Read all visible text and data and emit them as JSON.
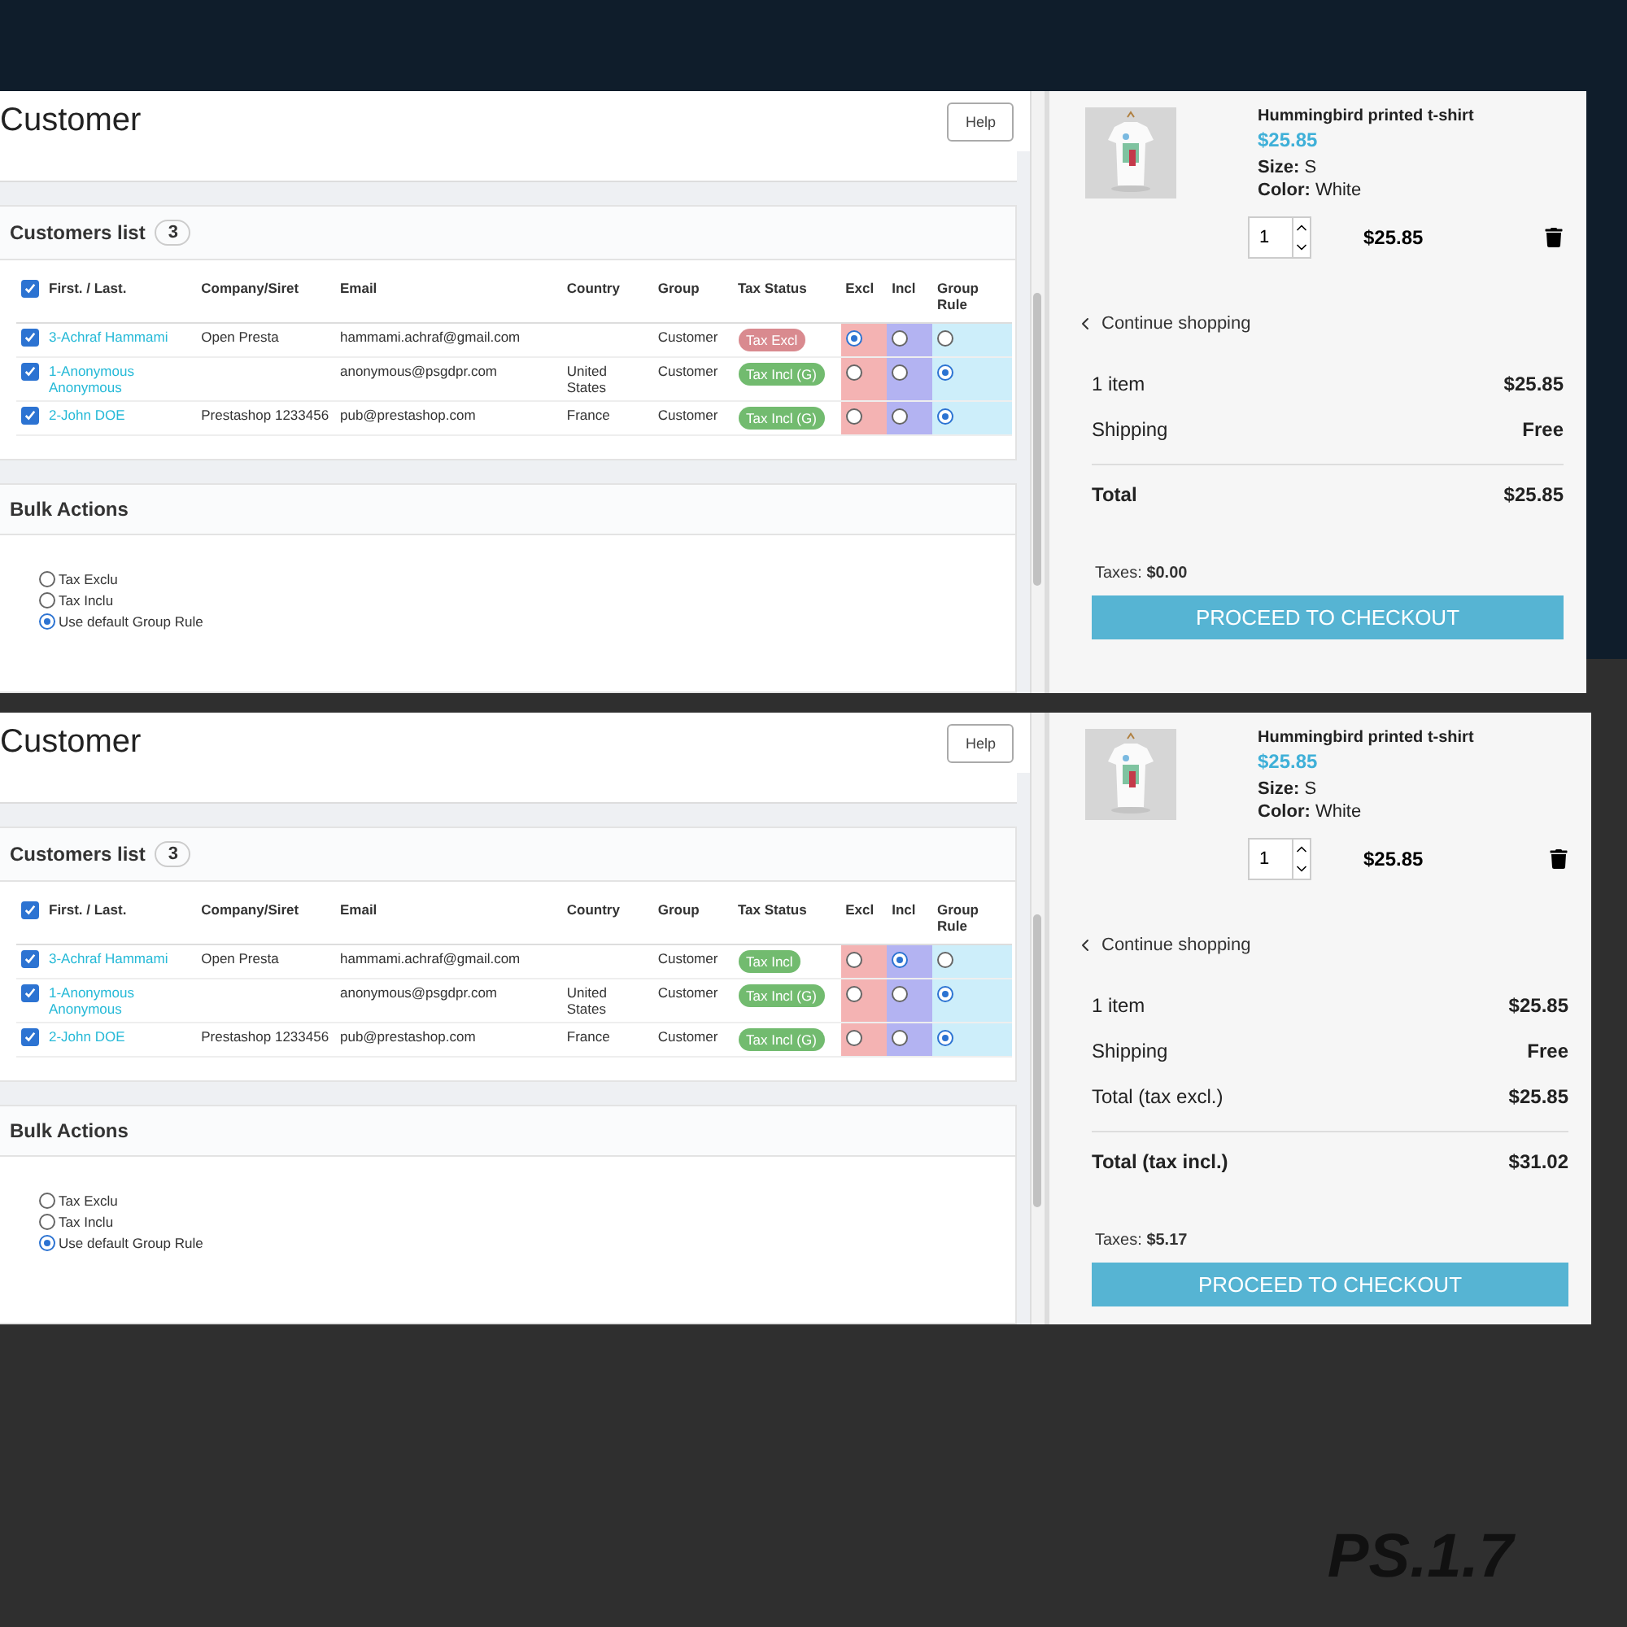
{
  "screens": [
    {
      "admin": {
        "title": "Customer",
        "help": "Help",
        "list_title": "Customers list",
        "count": "3",
        "select_all_checked": true,
        "columns": [
          "First. / Last.",
          "Company/Siret",
          "Email",
          "Country",
          "Group",
          "Tax Status",
          "Excl",
          "Incl",
          "Group Rule"
        ],
        "rows": [
          {
            "checked": true,
            "name": "3-Achraf Hammami",
            "company": "Open Presta",
            "email": "hammami.achraf@gmail.com",
            "group": "Customer",
            "tax": {
              "label": "Tax Excl",
              "color": "#d98a8f"
            },
            "choices": [
              {
                "selected": true
              },
              {
                "selected": false
              },
              {
                "selected": false
              }
            ]
          },
          {
            "checked": true,
            "name": "1-Anonymous Anonymous",
            "email": "anonymous@psgdpr.com",
            "country": "United States",
            "group": "Customer",
            "tax": {
              "label": "Tax Incl (G)",
              "color": "#72bb6f"
            },
            "choices": [
              {
                "selected": false
              },
              {
                "selected": false
              },
              {
                "selected": true
              }
            ]
          },
          {
            "checked": true,
            "name": "2-John DOE",
            "company": "Prestashop 1233456",
            "email": "pub@prestashop.com",
            "country": "France",
            "group": "Customer",
            "tax": {
              "label": "Tax Incl (G)",
              "color": "#72bb6f"
            },
            "choices": [
              {
                "selected": false
              },
              {
                "selected": false
              },
              {
                "selected": true
              }
            ]
          }
        ],
        "bulk_title": "Bulk Actions",
        "bulk_options": [
          {
            "label": "Tax Exclu",
            "selected": false
          },
          {
            "label": "Tax Inclu",
            "selected": false
          },
          {
            "label": "Use default Group Rule",
            "selected": true
          }
        ]
      },
      "cart": {
        "name": "Hummingbird printed t-shirt",
        "price": "$25.85",
        "attributes": [
          "**Size:** S",
          "**Color:** White"
        ],
        "qty": "1",
        "line_total": "$25.85",
        "continue": "Continue shopping",
        "summary": [
          {
            "kind": "line",
            "label": "1 item",
            "value": "$25.85"
          },
          {
            "kind": "line",
            "label": "Shipping",
            "value": "Free"
          },
          {
            "kind": "total",
            "label": "Total",
            "value": "$25.85"
          }
        ],
        "taxes": "Taxes: **$0.00**",
        "checkout": "PROCEED TO CHECKOUT"
      }
    },
    {
      "admin": {
        "title": "Customer",
        "help": "Help",
        "list_title": "Customers list",
        "count": "3",
        "select_all_checked": true,
        "columns": [
          "First. / Last.",
          "Company/Siret",
          "Email",
          "Country",
          "Group",
          "Tax Status",
          "Excl",
          "Incl",
          "Group Rule"
        ],
        "rows": [
          {
            "checked": true,
            "name": "3-Achraf Hammami",
            "company": "Open Presta",
            "email": "hammami.achraf@gmail.com",
            "group": "Customer",
            "tax": {
              "label": "Tax Incl",
              "color": "#72bb6f"
            },
            "choices": [
              {
                "selected": false
              },
              {
                "selected": true
              },
              {
                "selected": false
              }
            ]
          },
          {
            "checked": true,
            "name": "1-Anonymous Anonymous",
            "email": "anonymous@psgdpr.com",
            "country": "United States",
            "group": "Customer",
            "tax": {
              "label": "Tax Incl (G)",
              "color": "#72bb6f"
            },
            "choices": [
              {
                "selected": false
              },
              {
                "selected": false
              },
              {
                "selected": true
              }
            ]
          },
          {
            "checked": true,
            "name": "2-John DOE",
            "company": "Prestashop 1233456",
            "email": "pub@prestashop.com",
            "country": "France",
            "group": "Customer",
            "tax": {
              "label": "Tax Incl (G)",
              "color": "#72bb6f"
            },
            "choices": [
              {
                "selected": false
              },
              {
                "selected": false
              },
              {
                "selected": true
              }
            ]
          }
        ],
        "bulk_title": "Bulk Actions",
        "bulk_options": [
          {
            "label": "Tax Exclu",
            "selected": false
          },
          {
            "label": "Tax Inclu",
            "selected": false
          },
          {
            "label": "Use default Group Rule",
            "selected": true
          }
        ]
      },
      "cart": {
        "name": "Hummingbird printed t-shirt",
        "price": "$25.85",
        "attributes": [
          "**Size:** S",
          "**Color:** White"
        ],
        "qty": "1",
        "line_total": "$25.85",
        "continue": "Continue shopping",
        "summary": [
          {
            "kind": "line",
            "label": "1 item",
            "value": "$25.85"
          },
          {
            "kind": "line",
            "label": "Shipping",
            "value": "Free"
          },
          {
            "kind": "line",
            "label": "Total (tax excl.)",
            "value": "$25.85"
          },
          {
            "kind": "total",
            "label": "Total (tax incl.)",
            "value": "$31.02"
          }
        ],
        "taxes": "Taxes: **$5.17**",
        "checkout": "PROCEED TO CHECKOUT"
      }
    }
  ],
  "version": "PS.1.7"
}
